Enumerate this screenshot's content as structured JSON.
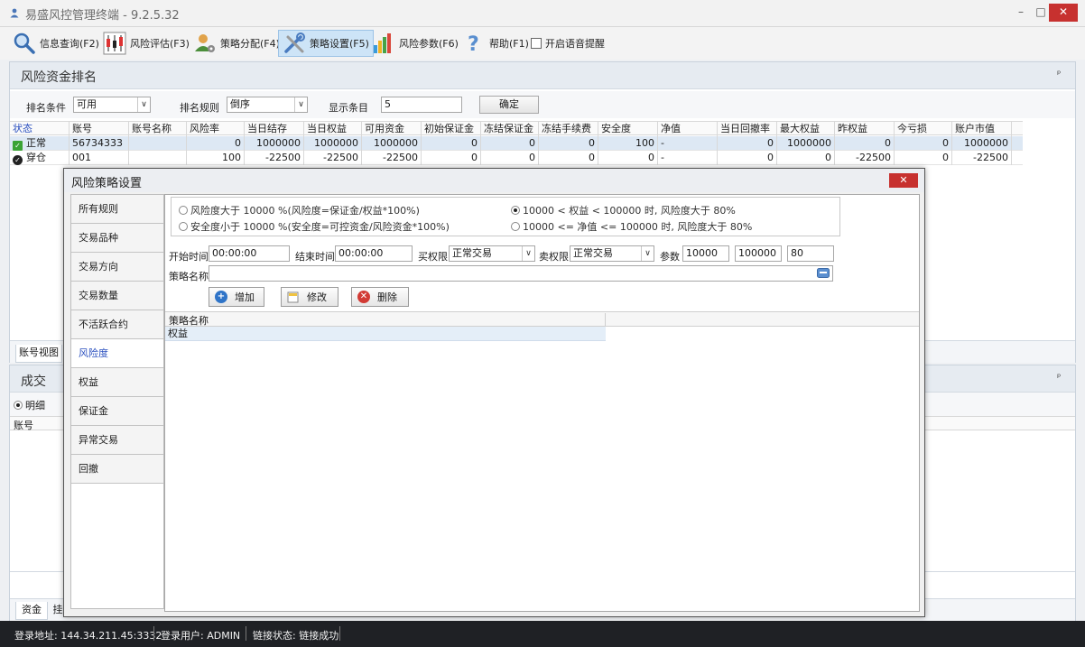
{
  "window": {
    "title": "易盛风控管理终端 - 9.2.5.32",
    "minimize": "–",
    "maximize": "□",
    "close": "✕"
  },
  "toolbar": {
    "items": [
      {
        "label": "信息查询(F2)",
        "icon": "magnifier-icon"
      },
      {
        "label": "风险评估(F3)",
        "icon": "candlestick-icon"
      },
      {
        "label": "策略分配(F4)",
        "icon": "user-gear-icon"
      },
      {
        "label": "策略设置(F5)",
        "icon": "tools-icon"
      },
      {
        "label": "风险参数(F6)",
        "icon": "bar-chart-icon"
      },
      {
        "label": "帮助(F1)",
        "icon": "help-icon"
      }
    ],
    "voice_label": "开启语音提醒"
  },
  "rank_panel": {
    "title": "风险资金排名",
    "pin": "ᵖ",
    "sort_condition_label": "排名条件",
    "sort_condition_value": "可用",
    "sort_rule_label": "排名规则",
    "sort_rule_value": "倒序",
    "display_count_label": "显示条目",
    "display_count_value": "5",
    "confirm_label": "确定",
    "columns": [
      "状态",
      "账号",
      "账号名称",
      "风险率",
      "当日结存",
      "当日权益",
      "可用资金",
      "初始保证金",
      "冻结保证金",
      "冻结手续费",
      "安全度",
      "净值",
      "当日回撤率",
      "最大权益",
      "昨权益",
      "今亏损",
      "账户市值"
    ],
    "rows": [
      {
        "status": "正常",
        "account": "56734333",
        "name": "",
        "risk": "0",
        "balance": "1000000",
        "equity": "1000000",
        "available": "1000000",
        "init_margin": "0",
        "frozen_margin": "0",
        "frozen_fee": "0",
        "safety": "100",
        "net": "-",
        "drawdown": "0",
        "max_equity": "1000000",
        "prev_equity": "0",
        "today_loss": "0",
        "market_value": "1000000"
      },
      {
        "status": "穿仓",
        "account": "001",
        "name": "",
        "risk": "100",
        "balance": "-22500",
        "equity": "-22500",
        "available": "-22500",
        "init_margin": "0",
        "frozen_margin": "0",
        "frozen_fee": "0",
        "safety": "0",
        "net": "-",
        "drawdown": "0",
        "max_equity": "0",
        "prev_equity": "-22500",
        "today_loss": "0",
        "market_value": "-22500"
      }
    ],
    "bottom_tab": "账号视图"
  },
  "lower_panel": {
    "title": "成交",
    "pin": "ᵖ",
    "radio_detail": "明细",
    "col_account": "账号",
    "tab_funds": "资金",
    "tab_partial": "挂"
  },
  "dialog": {
    "title": "风险策略设置",
    "close": "✕",
    "nav": [
      "所有规则",
      "交易品种",
      "交易方向",
      "交易数量",
      "不活跃合约",
      "风险度",
      "权益",
      "保证金",
      "异常交易",
      "回撤"
    ],
    "active_nav_index": 5,
    "rules": {
      "r1": "风险度大于 10000 %(风险度=保证金/权益*100%)",
      "r2": "安全度小于 10000 %(安全度=可控资金/风险资金*100%)",
      "r3": "10000 < 权益 < 100000 时, 风险度大于 80%",
      "r4": "10000 <= 净值 <= 100000 时, 风险度大于 80%",
      "selected": "r3"
    },
    "form": {
      "start_time_label": "开始时间",
      "start_time": "00:00:00",
      "end_time_label": "结束时间",
      "end_time": "00:00:00",
      "buy_perm_label": "买权限",
      "buy_perm": "正常交易",
      "sell_perm_label": "卖权限",
      "sell_perm": "正常交易",
      "param_label": "参数",
      "param1": "10000",
      "param2": "100000",
      "param3": "80",
      "name_label": "策略名称",
      "name_value": ""
    },
    "buttons": {
      "add": "增加",
      "edit": "修改",
      "delete": "删除"
    },
    "table": {
      "header": "策略名称",
      "rows": [
        "权益"
      ]
    }
  },
  "statusbar": {
    "address": "登录地址: 144.34.211.45:3332",
    "user": "登录用户: ADMIN",
    "link": "链接状态: 链接成功"
  },
  "colors": {
    "accent": "#2a4fbf",
    "close_red": "#c7312f",
    "ok_green": "#3aa335",
    "status_bar": "#1f2125",
    "selection": "#dde8f4"
  }
}
